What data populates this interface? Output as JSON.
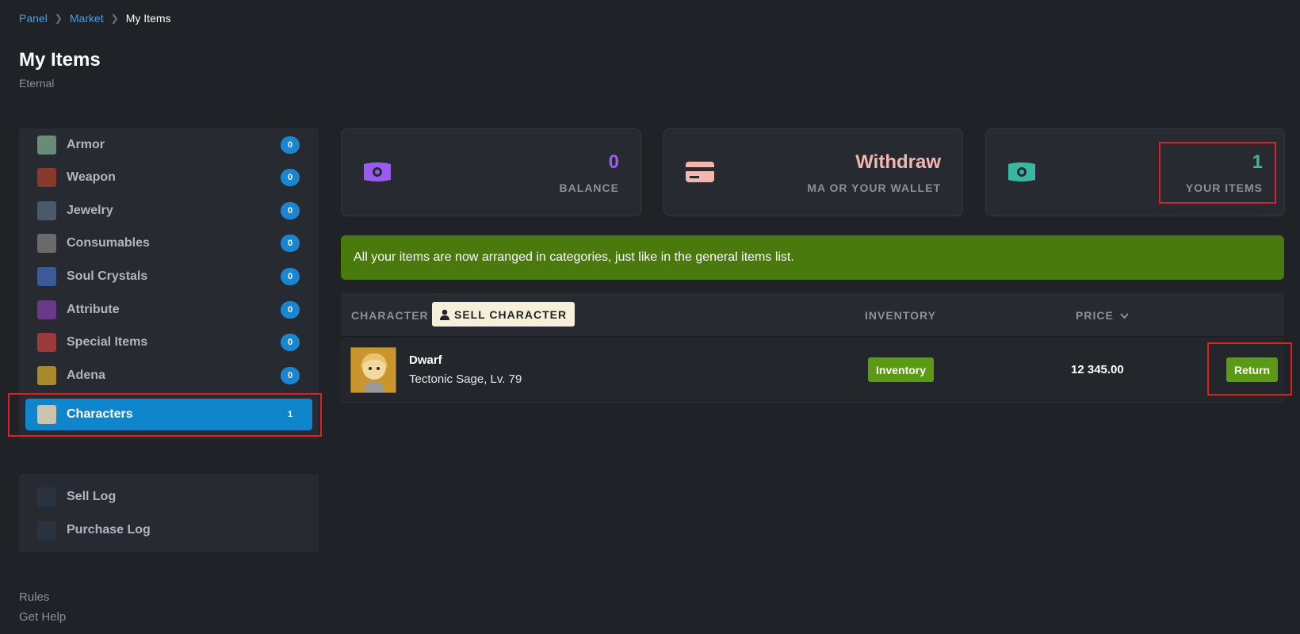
{
  "breadcrumb": {
    "items": [
      "Panel",
      "Market"
    ],
    "current": "My Items"
  },
  "page": {
    "title": "My Items",
    "subtitle": "Eternal"
  },
  "sidebar": {
    "items": [
      {
        "label": "Armor",
        "count": "0",
        "icon": "armor-icon",
        "color": "#6a8a7a"
      },
      {
        "label": "Weapon",
        "count": "0",
        "icon": "weapon-icon",
        "color": "#8a3a2a"
      },
      {
        "label": "Jewelry",
        "count": "0",
        "icon": "jewelry-icon",
        "color": "#4a5a6a"
      },
      {
        "label": "Consumables",
        "count": "0",
        "icon": "consumables-icon",
        "color": "#6a6a6a"
      },
      {
        "label": "Soul Crystals",
        "count": "0",
        "icon": "soul-crystal-icon",
        "color": "#3a5a9a"
      },
      {
        "label": "Attribute",
        "count": "0",
        "icon": "attribute-icon",
        "color": "#6a3a8a"
      },
      {
        "label": "Special Items",
        "count": "0",
        "icon": "special-items-icon",
        "color": "#9a3a3a"
      },
      {
        "label": "Adena",
        "count": "0",
        "icon": "adena-icon",
        "color": "#a88a2a"
      },
      {
        "label": "Characters",
        "count": "1",
        "icon": "characters-icon",
        "color": "#c9c3b0"
      }
    ]
  },
  "logs": {
    "items": [
      {
        "label": "Sell Log",
        "icon": "sell-log-icon"
      },
      {
        "label": "Purchase Log",
        "icon": "purchase-log-icon"
      }
    ]
  },
  "footer": {
    "rules": "Rules",
    "help": "Get Help"
  },
  "cards": {
    "balance": {
      "value": "0",
      "caption": "BALANCE",
      "color": "#9a5cf0",
      "icon": "money-icon"
    },
    "withdraw": {
      "value": "Withdraw",
      "caption": "MA OR YOUR WALLET",
      "color": "#f2b8b0",
      "icon": "credit-card-icon"
    },
    "items": {
      "value": "1",
      "caption": "YOUR ITEMS",
      "color": "#38b8a0",
      "icon": "money-icon"
    }
  },
  "notice": "All your items are now arranged in categories, just like in the general items list.",
  "table": {
    "headers": {
      "character": "CHARACTER",
      "sell": "SELL CHARACTER",
      "inventory": "INVENTORY",
      "price": "PRICE"
    },
    "rows": [
      {
        "name": "Dwarf",
        "class": "Tectonic Sage, Lv. 79",
        "inventory": "Inventory",
        "price": "12 345.00",
        "action": "Return"
      }
    ]
  }
}
